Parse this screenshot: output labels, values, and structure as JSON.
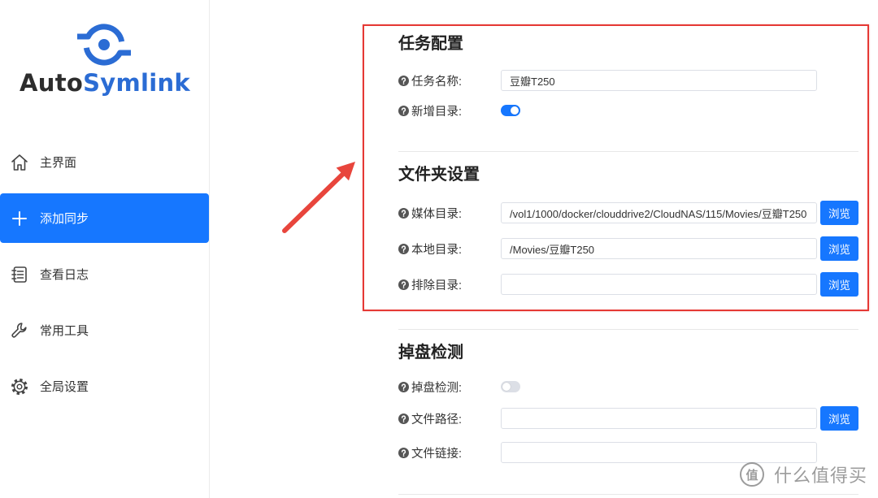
{
  "brand": {
    "name_part1": "Auto",
    "name_part2": "Symlink",
    "logo_icon": "autosymlink-logo-icon"
  },
  "colors": {
    "primary": "#1677ff",
    "brand": "#2b6cd4",
    "annotation_red": "#e53935"
  },
  "sidebar": {
    "items": [
      {
        "label": "主界面",
        "icon": "home-icon",
        "active": false
      },
      {
        "label": "添加同步",
        "icon": "plus-icon",
        "active": true
      },
      {
        "label": "查看日志",
        "icon": "log-icon",
        "active": false
      },
      {
        "label": "常用工具",
        "icon": "wrench-icon",
        "active": false
      },
      {
        "label": "全局设置",
        "icon": "gear-icon",
        "active": false
      }
    ]
  },
  "help_icon": "question-circle-icon",
  "buttons": {
    "browse": "浏览"
  },
  "task": {
    "title": "任务配置",
    "name_label": "任务名称:",
    "name_value": "豆瓣T250",
    "new_dir_label": "新增目录:",
    "new_dir_on": true
  },
  "folder": {
    "title": "文件夹设置",
    "media_label": "媒体目录:",
    "media_value": "/vol1/1000/docker/clouddrive2/CloudNAS/115/Movies/豆瓣T250",
    "local_label": "本地目录:",
    "local_value": "/Movies/豆瓣T250",
    "exclude_label": "排除目录:",
    "exclude_value": ""
  },
  "drop_check": {
    "title": "掉盘检测",
    "check_label": "掉盘检测:",
    "check_on": false,
    "path_label": "文件路径:",
    "path_value": "",
    "link_label": "文件链接:",
    "link_value": ""
  },
  "watermark": {
    "badge": "值",
    "text": "什么值得买"
  }
}
